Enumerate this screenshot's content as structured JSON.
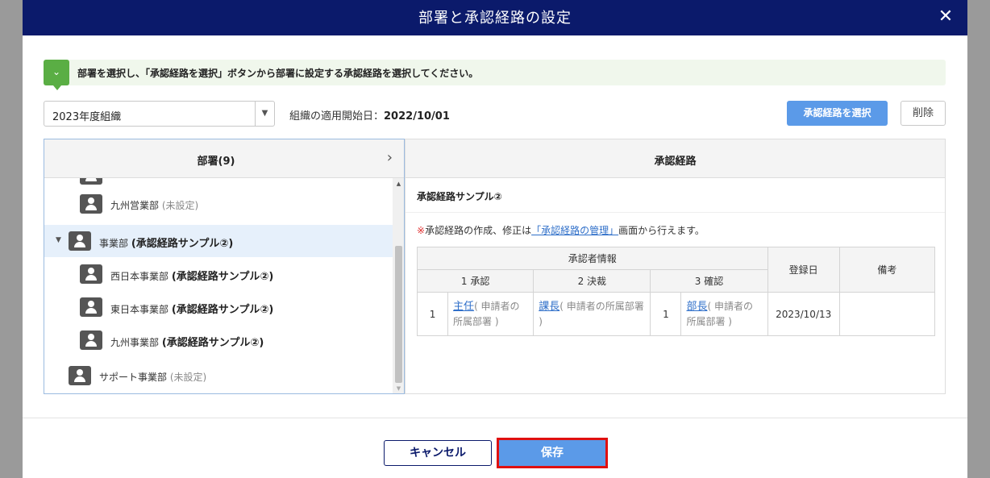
{
  "header": {
    "title": "部署と承認経路の設定",
    "close_icon": "close-icon"
  },
  "banner": {
    "text": "部署を選択し、「承認経路を選択」ボタンから部署に設定する承認経路を選択してください。"
  },
  "org": {
    "selected": "2023年度組織",
    "start_label": "組織の適用開始日：",
    "start_date": "2022/10/01"
  },
  "toolbar": {
    "select_route_label": "承認経路を選択",
    "delete_label": "削除"
  },
  "dept_panel": {
    "title": "部署(9)",
    "items": [
      {
        "name": "九州営業部",
        "status": "(未設定)"
      },
      {
        "name": "事業部",
        "route": "(承認経路サンプル②)"
      },
      {
        "name": "西日本事業部",
        "route": "(承認経路サンプル②)"
      },
      {
        "name": "東日本事業部",
        "route": "(承認経路サンプル②)"
      },
      {
        "name": "九州事業部",
        "route": "(承認経路サンプル②)"
      },
      {
        "name": "サポート事業部",
        "status": "(未設定)"
      }
    ]
  },
  "route_panel": {
    "title": "承認経路",
    "route_name": "承認経路サンプル②",
    "note_mark": "※",
    "note_prefix": "承認経路の作成、修正は",
    "note_link": "「承認経路の管理」",
    "note_suffix": "画面から行えます。",
    "table": {
      "group_header": "承認者情報",
      "steps": [
        "1 承認",
        "2 決裁",
        "3 確認"
      ],
      "date_header": "登録日",
      "remarks_header": "備考",
      "row": {
        "num1": "1",
        "step1_role": "主任",
        "step1_note": "( 申請者の所属部署 )",
        "step2_role": "課長",
        "step2_note": "( 申請者の所属部署 )",
        "num3": "1",
        "step3_role": "部長",
        "step3_note": "( 申請者の所属部署 )",
        "date": "2023/10/13",
        "remarks": ""
      }
    }
  },
  "footer": {
    "cancel_label": "キャンセル",
    "save_label": "保存"
  }
}
